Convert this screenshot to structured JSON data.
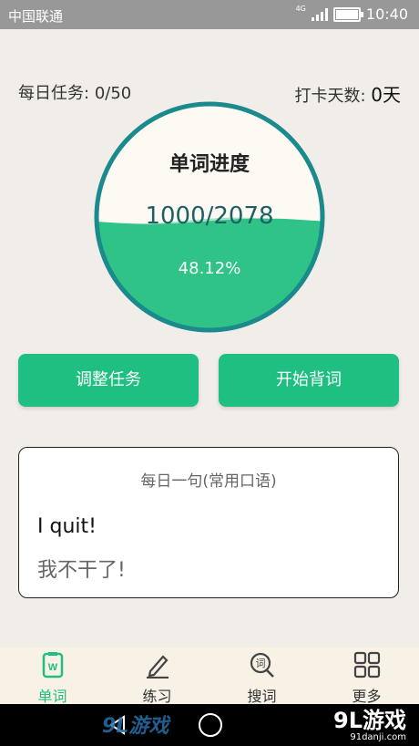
{
  "status_bar": {
    "carrier": "中国联通",
    "network": "4G",
    "time": "10:40"
  },
  "header": {
    "daily_task_label": "每日任务:",
    "daily_task_value": "0/50",
    "checkin_label": "打卡天数:",
    "checkin_value": "0天"
  },
  "progress": {
    "title": "单词进度",
    "learned": "1000/2078",
    "percent_text": "48.12%",
    "fraction": 0.4812
  },
  "buttons": {
    "adjust": "调整任务",
    "start": "开始背词"
  },
  "daily_sentence": {
    "title": "每日一句(常用口语)",
    "english": "I quit!",
    "chinese": "我不干了!"
  },
  "tabs": [
    {
      "label": "单词",
      "icon": "word-book-icon"
    },
    {
      "label": "练习",
      "icon": "pencil-icon"
    },
    {
      "label": "搜词",
      "icon": "search-word-icon"
    },
    {
      "label": "更多",
      "icon": "grid-icon"
    }
  ],
  "watermark": {
    "left": "9L游戏",
    "right": "9L游戏",
    "site": "91danji.com"
  },
  "colors": {
    "accent": "#1fbf82",
    "ring": "#1a8a8c"
  }
}
